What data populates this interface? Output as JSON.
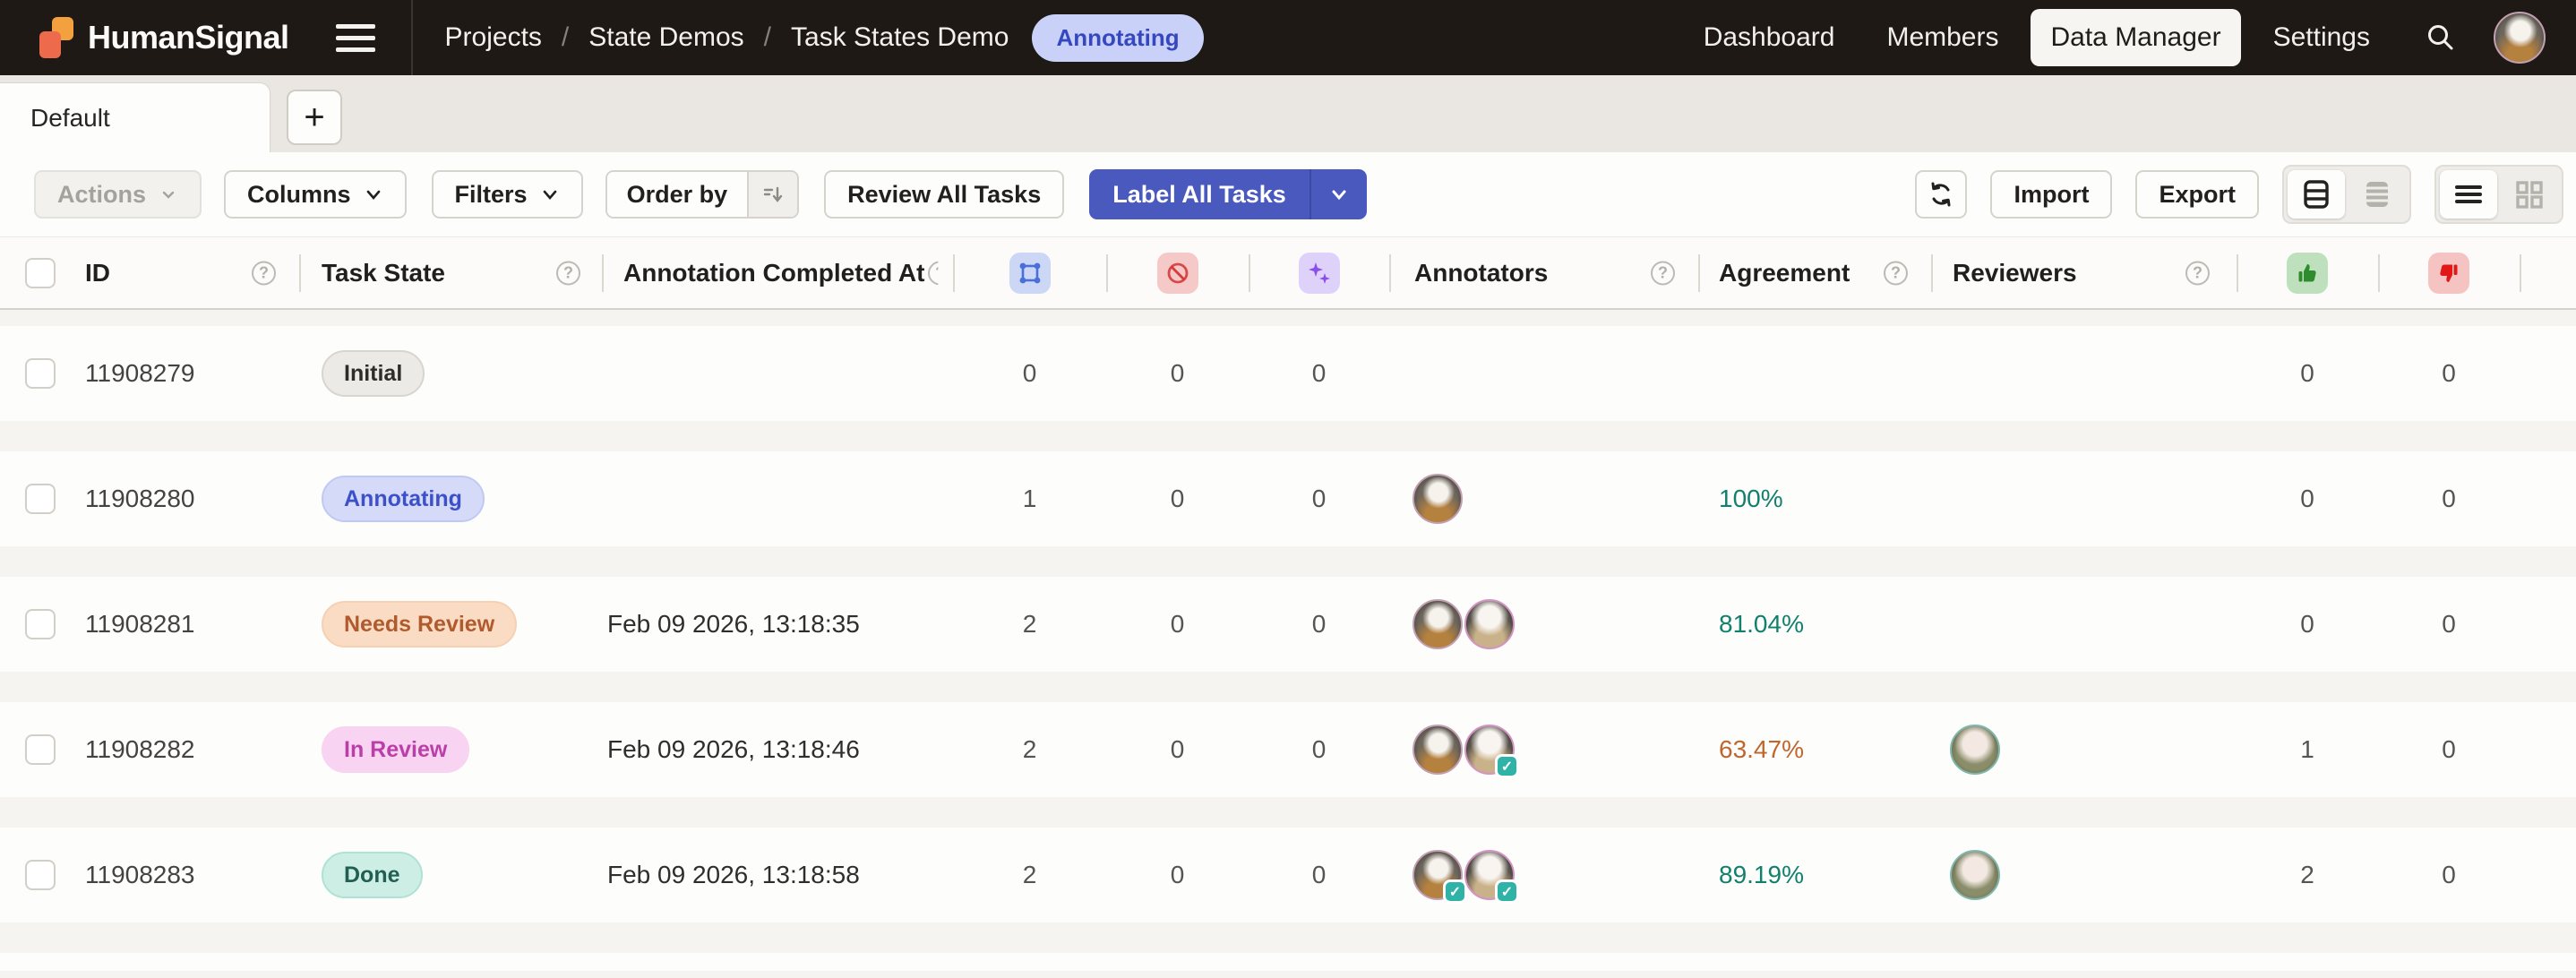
{
  "topbar": {
    "logo_text": "HumanSignal",
    "breadcrumbs": [
      "Projects",
      "State Demos",
      "Task States Demo"
    ],
    "project_status_badge": "Annotating",
    "nav": [
      {
        "label": "Dashboard",
        "active": false
      },
      {
        "label": "Members",
        "active": false
      },
      {
        "label": "Data Manager",
        "active": true
      },
      {
        "label": "Settings",
        "active": false
      }
    ]
  },
  "tabs": {
    "items": [
      {
        "label": "Default",
        "active": true
      }
    ],
    "add_button": "+"
  },
  "toolbar": {
    "actions_label": "Actions",
    "columns_label": "Columns",
    "filters_label": "Filters",
    "order_by_label": "Order by",
    "review_all_label": "Review All Tasks",
    "label_all_label": "Label All Tasks",
    "import_label": "Import",
    "export_label": "Export"
  },
  "colors": {
    "accent_indigo": "#4a59bd",
    "badge_annotating": "#d4daf8",
    "badge_needs_review": "#fadcc4",
    "badge_in_review": "#f8d3f2",
    "badge_done": "#cdeee4",
    "agreement_teal": "#11806d",
    "agreement_orange": "#c0662c"
  },
  "table": {
    "columns": {
      "id": "ID",
      "task_state": "Task State",
      "annotation_completed_at": "Annotation Completed At",
      "annotations_icon": "blue-regions-icon",
      "cancelled_icon": "red-cancelled-icon",
      "predictions_icon": "purple-sparkles-icon",
      "annotators": "Annotators",
      "agreement": "Agreement",
      "reviewers": "Reviewers",
      "accepted_icon": "green-thumb-up-icon",
      "rejected_icon": "red-thumb-down-icon"
    },
    "rows": [
      {
        "id": "11908279",
        "state": "Initial",
        "state_key": "initial",
        "completed_at": "",
        "annotations": "0",
        "cancelled": "0",
        "predictions": "0",
        "annotators": [],
        "agreement": "",
        "agreement_tone": "",
        "reviewers": [],
        "accepted": "0",
        "rejected": "0"
      },
      {
        "id": "11908280",
        "state": "Annotating",
        "state_key": "annotating",
        "completed_at": "",
        "annotations": "1",
        "cancelled": "0",
        "predictions": "0",
        "annotators": [
          {
            "variant": "a",
            "verified": false
          }
        ],
        "agreement": "100%",
        "agreement_tone": "teal",
        "reviewers": [],
        "accepted": "0",
        "rejected": "0"
      },
      {
        "id": "11908281",
        "state": "Needs Review",
        "state_key": "needs_review",
        "completed_at": "Feb 09 2026, 13:18:35",
        "annotations": "2",
        "cancelled": "0",
        "predictions": "0",
        "annotators": [
          {
            "variant": "a",
            "verified": false
          },
          {
            "variant": "b",
            "verified": false
          }
        ],
        "agreement": "81.04%",
        "agreement_tone": "teal",
        "reviewers": [],
        "accepted": "0",
        "rejected": "0"
      },
      {
        "id": "11908282",
        "state": "In Review",
        "state_key": "in_review",
        "completed_at": "Feb 09 2026, 13:18:46",
        "annotations": "2",
        "cancelled": "0",
        "predictions": "0",
        "annotators": [
          {
            "variant": "a",
            "verified": false
          },
          {
            "variant": "b",
            "verified": true
          }
        ],
        "agreement": "63.47%",
        "agreement_tone": "orange",
        "reviewers": [
          {
            "variant": "c"
          }
        ],
        "accepted": "1",
        "rejected": "0"
      },
      {
        "id": "11908283",
        "state": "Done",
        "state_key": "done",
        "completed_at": "Feb 09 2026, 13:18:58",
        "annotations": "2",
        "cancelled": "0",
        "predictions": "0",
        "annotators": [
          {
            "variant": "a",
            "verified": true
          },
          {
            "variant": "b",
            "verified": true
          }
        ],
        "agreement": "89.19%",
        "agreement_tone": "teal",
        "reviewers": [
          {
            "variant": "c"
          }
        ],
        "accepted": "2",
        "rejected": "0"
      }
    ]
  }
}
